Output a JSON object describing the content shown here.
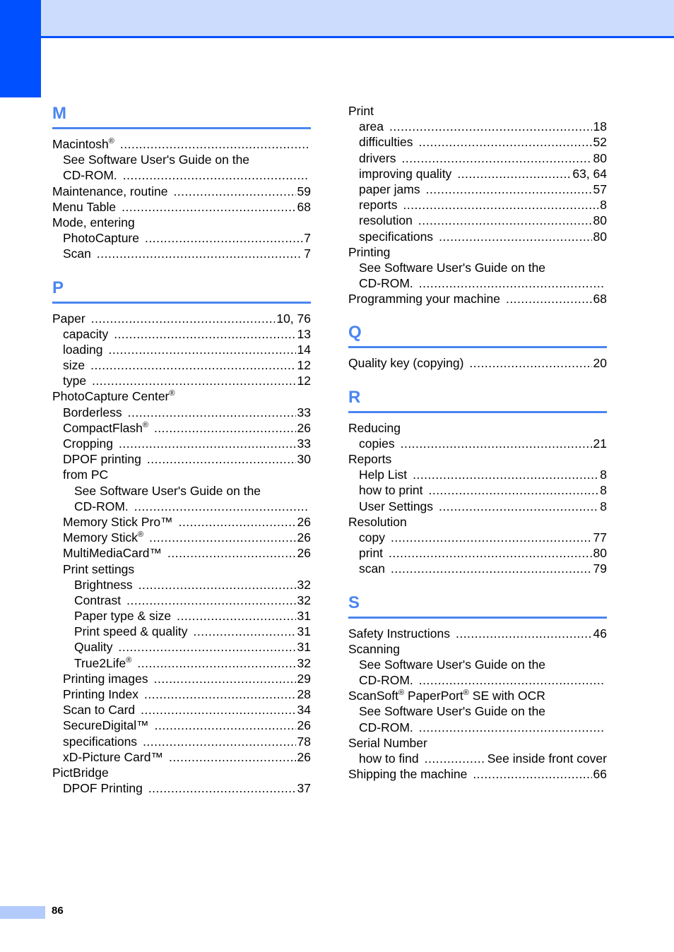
{
  "colors": {
    "brand_blue": "#0050ff",
    "header_band": "#ccdcfd",
    "heading_blue": "#4a86f0",
    "footer_bar": "#b3cbfb"
  },
  "page_number": "86",
  "left_column": [
    {
      "letter": "M",
      "entries": [
        {
          "level": 0,
          "label": "Macintosh",
          "sup": "®",
          "page": ""
        },
        {
          "level": 1,
          "label": "See Software User's Guide on the",
          "page": "",
          "no_leader": true
        },
        {
          "level": 1,
          "label": "CD-ROM.",
          "page": ""
        },
        {
          "level": 0,
          "label": "Maintenance, routine",
          "page": "59"
        },
        {
          "level": 0,
          "label": "Menu Table",
          "page": "68"
        },
        {
          "level": 0,
          "label": "Mode, entering",
          "page": "",
          "no_leader": true
        },
        {
          "level": 1,
          "label": "PhotoCapture",
          "page": "7"
        },
        {
          "level": 1,
          "label": "Scan",
          "page": "7"
        }
      ]
    },
    {
      "letter": "P",
      "entries": [
        {
          "level": 0,
          "label": "Paper",
          "page": "10, 76"
        },
        {
          "level": 1,
          "label": "capacity",
          "page": "13"
        },
        {
          "level": 1,
          "label": "loading",
          "page": "14"
        },
        {
          "level": 1,
          "label": "size",
          "page": "12"
        },
        {
          "level": 1,
          "label": "type",
          "page": "12"
        },
        {
          "level": 0,
          "label": "PhotoCapture Center",
          "sup": "®",
          "page": "",
          "no_leader": true
        },
        {
          "level": 1,
          "label": "Borderless",
          "page": "33"
        },
        {
          "level": 1,
          "label": "CompactFlash",
          "sup": "®",
          "page": "26"
        },
        {
          "level": 1,
          "label": "Cropping",
          "page": "33"
        },
        {
          "level": 1,
          "label": "DPOF printing",
          "page": "30"
        },
        {
          "level": 1,
          "label": "from PC",
          "page": "",
          "no_leader": true
        },
        {
          "level": 2,
          "label": "See Software User's Guide on the",
          "page": "",
          "no_leader": true
        },
        {
          "level": 2,
          "label": "CD-ROM.",
          "page": ""
        },
        {
          "level": 1,
          "label": "Memory Stick Pro™",
          "page": "26"
        },
        {
          "level": 1,
          "label": "Memory Stick",
          "sup": "®",
          "page": "26"
        },
        {
          "level": 1,
          "label": "MultiMediaCard™",
          "page": "26"
        },
        {
          "level": 1,
          "label": "Print settings",
          "page": "",
          "no_leader": true
        },
        {
          "level": 2,
          "label": "Brightness",
          "page": "32"
        },
        {
          "level": 2,
          "label": "Contrast",
          "page": "32"
        },
        {
          "level": 2,
          "label": "Paper type & size",
          "page": "31"
        },
        {
          "level": 2,
          "label": "Print speed & quality",
          "page": "31"
        },
        {
          "level": 2,
          "label": "Quality",
          "page": "31"
        },
        {
          "level": 2,
          "label": "True2Life",
          "sup": "®",
          "page": "32"
        },
        {
          "level": 1,
          "label": "Printing images",
          "page": "29"
        },
        {
          "level": 1,
          "label": "Printing Index",
          "page": "28"
        },
        {
          "level": 1,
          "label": "Scan to Card",
          "page": "34"
        },
        {
          "level": 1,
          "label": "SecureDigital™",
          "page": "26"
        },
        {
          "level": 1,
          "label": "specifications",
          "page": "78"
        },
        {
          "level": 1,
          "label": "xD-Picture Card™",
          "page": "26"
        },
        {
          "level": 0,
          "label": "PictBridge",
          "page": "",
          "no_leader": true
        },
        {
          "level": 1,
          "label": "DPOF Printing",
          "page": "37"
        }
      ]
    }
  ],
  "right_column": [
    {
      "letter": "",
      "entries": [
        {
          "level": 0,
          "label": "Print",
          "page": "",
          "no_leader": true
        },
        {
          "level": 1,
          "label": "area",
          "page": "18"
        },
        {
          "level": 1,
          "label": "difficulties",
          "page": "52"
        },
        {
          "level": 1,
          "label": "drivers",
          "page": "80"
        },
        {
          "level": 1,
          "label": "improving quality",
          "page": "63, 64"
        },
        {
          "level": 1,
          "label": "paper jams",
          "page": "57"
        },
        {
          "level": 1,
          "label": "reports",
          "page": "8"
        },
        {
          "level": 1,
          "label": "resolution",
          "page": "80"
        },
        {
          "level": 1,
          "label": "specifications",
          "page": "80"
        },
        {
          "level": 0,
          "label": "Printing",
          "page": "",
          "no_leader": true
        },
        {
          "level": 1,
          "label": "See Software User's Guide on the",
          "page": "",
          "no_leader": true
        },
        {
          "level": 1,
          "label": "CD-ROM.",
          "page": ""
        },
        {
          "level": 0,
          "label": "Programming your machine",
          "page": "68"
        }
      ]
    },
    {
      "letter": "Q",
      "entries": [
        {
          "level": 0,
          "label": "Quality key (copying)",
          "page": "20"
        }
      ]
    },
    {
      "letter": "R",
      "entries": [
        {
          "level": 0,
          "label": "Reducing",
          "page": "",
          "no_leader": true
        },
        {
          "level": 1,
          "label": "copies",
          "page": "21"
        },
        {
          "level": 0,
          "label": "Reports",
          "page": "",
          "no_leader": true
        },
        {
          "level": 1,
          "label": "Help List",
          "page": "8"
        },
        {
          "level": 1,
          "label": "how to print",
          "page": "8"
        },
        {
          "level": 1,
          "label": "User Settings",
          "page": "8"
        },
        {
          "level": 0,
          "label": "Resolution",
          "page": "",
          "no_leader": true
        },
        {
          "level": 1,
          "label": "copy",
          "page": "77"
        },
        {
          "level": 1,
          "label": "print",
          "page": "80"
        },
        {
          "level": 1,
          "label": "scan",
          "page": "79"
        }
      ]
    },
    {
      "letter": "S",
      "entries": [
        {
          "level": 0,
          "label": "Safety Instructions",
          "page": "46"
        },
        {
          "level": 0,
          "label": "Scanning",
          "page": "",
          "no_leader": true
        },
        {
          "level": 1,
          "label": "See Software User's Guide on the",
          "page": "",
          "no_leader": true
        },
        {
          "level": 1,
          "label": "CD-ROM.",
          "page": ""
        },
        {
          "level": 0,
          "label": "ScanSoft",
          "sup": "®",
          "label2": " PaperPort",
          "sup2": "®",
          "label3": " SE with OCR",
          "page": "",
          "no_leader": true
        },
        {
          "level": 1,
          "label": "See Software User's Guide on the",
          "page": "",
          "no_leader": true
        },
        {
          "level": 1,
          "label": "CD-ROM.",
          "page": ""
        },
        {
          "level": 0,
          "label": "Serial Number",
          "page": "",
          "no_leader": true
        },
        {
          "level": 1,
          "label": "how to find",
          "page": "See inside front cover"
        },
        {
          "level": 0,
          "label": "Shipping the machine",
          "page": "66"
        }
      ]
    }
  ]
}
